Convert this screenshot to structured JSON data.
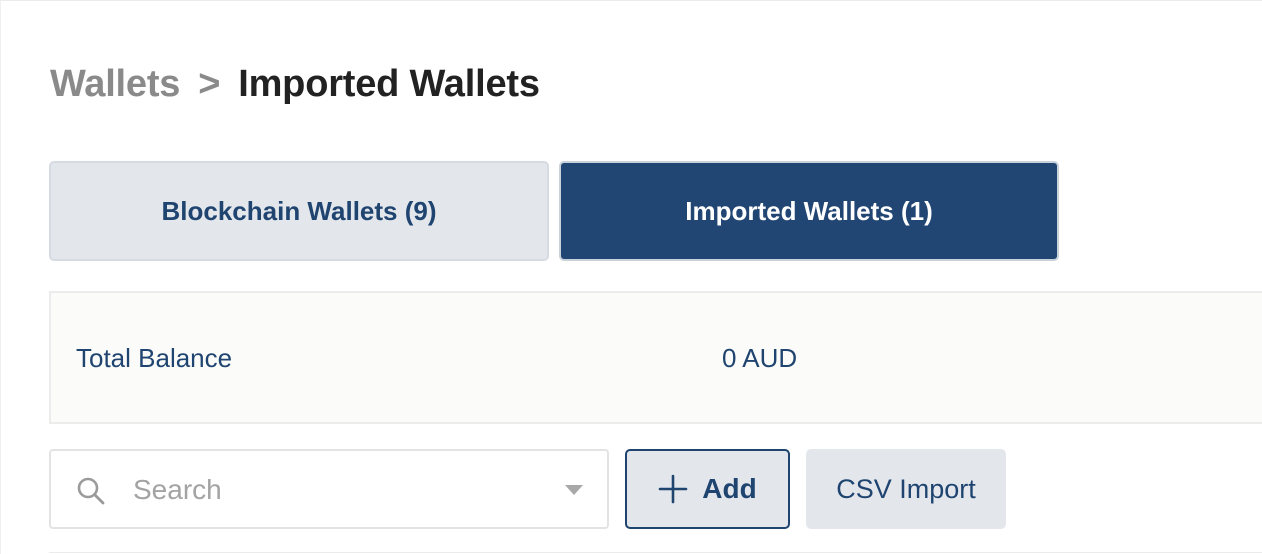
{
  "breadcrumb": {
    "parent": "Wallets",
    "separator": ">",
    "current": "Imported Wallets"
  },
  "tabs": [
    {
      "label": "Blockchain Wallets (9)",
      "active": false
    },
    {
      "label": "Imported Wallets (1)",
      "active": true
    }
  ],
  "balance": {
    "label": "Total Balance",
    "value": "0 AUD"
  },
  "search": {
    "placeholder": "Search",
    "value": "",
    "icon": "search-icon",
    "dropdown_icon": "chevron-down-icon"
  },
  "actions": {
    "add_label": "Add",
    "add_icon": "plus-icon",
    "csv_import_label": "CSV Import"
  },
  "colors": {
    "primary": "#214673",
    "text_primary": "#1f4470",
    "tab_inactive_bg": "#e3e7ec",
    "muted": "#8a8a8a"
  }
}
